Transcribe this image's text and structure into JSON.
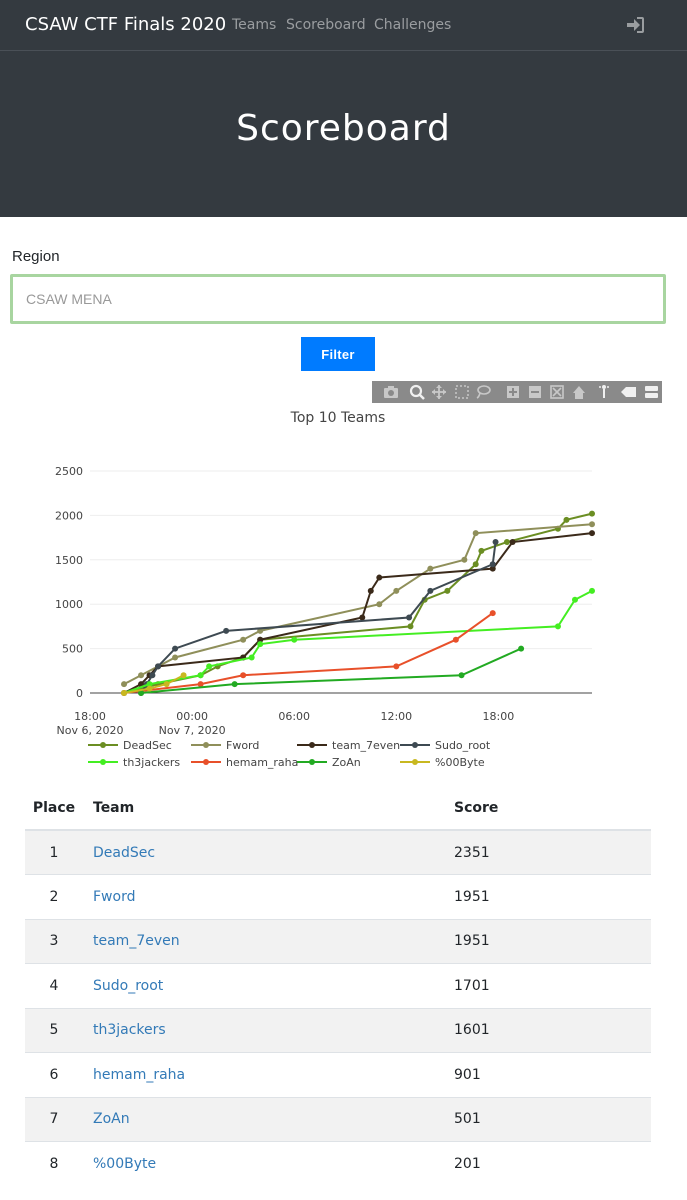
{
  "nav": {
    "brand": "CSAW CTF Finals 2020",
    "links": [
      "Teams",
      "Scoreboard",
      "Challenges"
    ]
  },
  "header": {
    "title": "Scoreboard"
  },
  "filter": {
    "label": "Region",
    "placeholder": "CSAW MENA",
    "button_label": "Filter"
  },
  "colors": {
    "nav_bg": "#343a40",
    "accent": "#007bff",
    "link": "#337ab7"
  },
  "chart_data": {
    "type": "line",
    "title": "Top 10 Teams",
    "xlabel": "",
    "ylabel": "",
    "ylim": [
      0,
      2500
    ],
    "yticks": [
      0,
      500,
      1000,
      1500,
      2000,
      2500
    ],
    "xlim": [
      "2020-11-06T18:00",
      "2020-11-07T23:30"
    ],
    "xticks": [
      {
        "at": "2020-11-06T18:00",
        "label": "18:00",
        "sub": "Nov 6, 2020"
      },
      {
        "at": "2020-11-07T00:00",
        "label": "00:00",
        "sub": "Nov 7, 2020"
      },
      {
        "at": "2020-11-07T06:00",
        "label": "06:00",
        "sub": ""
      },
      {
        "at": "2020-11-07T12:00",
        "label": "12:00",
        "sub": ""
      },
      {
        "at": "2020-11-07T18:00",
        "label": "18:00",
        "sub": ""
      }
    ],
    "legend_position": "bottom",
    "series": [
      {
        "name": "DeadSec",
        "color": "#6b8e23",
        "points": [
          [
            "2020-11-06T20:00",
            0
          ],
          [
            "2020-11-06T21:00",
            50
          ],
          [
            "2020-11-06T22:00",
            100
          ],
          [
            "2020-11-07T00:30",
            200
          ],
          [
            "2020-11-07T01:30",
            300
          ],
          [
            "2020-11-07T03:00",
            400
          ],
          [
            "2020-11-07T04:00",
            600
          ],
          [
            "2020-11-07T12:50",
            750
          ],
          [
            "2020-11-07T13:40",
            1050
          ],
          [
            "2020-11-07T15:00",
            1150
          ],
          [
            "2020-11-07T16:40",
            1450
          ],
          [
            "2020-11-07T17:00",
            1600
          ],
          [
            "2020-11-07T18:30",
            1700
          ],
          [
            "2020-11-07T21:30",
            1850
          ],
          [
            "2020-11-07T22:00",
            1950
          ],
          [
            "2020-11-07T23:30",
            2020
          ]
        ]
      },
      {
        "name": "Fword",
        "color": "#8f8f5a",
        "points": [
          [
            "2020-11-06T20:00",
            100
          ],
          [
            "2020-11-06T21:00",
            200
          ],
          [
            "2020-11-06T23:00",
            400
          ],
          [
            "2020-11-07T03:00",
            600
          ],
          [
            "2020-11-07T04:00",
            700
          ],
          [
            "2020-11-07T11:00",
            1000
          ],
          [
            "2020-11-07T12:00",
            1150
          ],
          [
            "2020-11-07T14:00",
            1400
          ],
          [
            "2020-11-07T16:00",
            1500
          ],
          [
            "2020-11-07T16:40",
            1800
          ],
          [
            "2020-11-07T23:30",
            1900
          ]
        ]
      },
      {
        "name": "team_7even",
        "color": "#3b2a1a",
        "points": [
          [
            "2020-11-06T20:00",
            0
          ],
          [
            "2020-11-06T21:00",
            100
          ],
          [
            "2020-11-06T21:30",
            200
          ],
          [
            "2020-11-06T22:00",
            300
          ],
          [
            "2020-11-07T03:00",
            400
          ],
          [
            "2020-11-07T04:00",
            600
          ],
          [
            "2020-11-07T10:00",
            850
          ],
          [
            "2020-11-07T10:30",
            1150
          ],
          [
            "2020-11-07T11:00",
            1300
          ],
          [
            "2020-11-07T17:40",
            1400
          ],
          [
            "2020-11-07T18:50",
            1700
          ],
          [
            "2020-11-07T23:30",
            1800
          ]
        ]
      },
      {
        "name": "Sudo_root",
        "color": "#3e4a52",
        "points": [
          [
            "2020-11-06T21:00",
            0
          ],
          [
            "2020-11-06T21:20",
            100
          ],
          [
            "2020-11-06T21:40",
            200
          ],
          [
            "2020-11-06T22:00",
            300
          ],
          [
            "2020-11-06T23:00",
            500
          ],
          [
            "2020-11-07T02:00",
            700
          ],
          [
            "2020-11-07T12:45",
            850
          ],
          [
            "2020-11-07T14:00",
            1150
          ],
          [
            "2020-11-07T17:40",
            1450
          ],
          [
            "2020-11-07T17:50",
            1700
          ]
        ]
      },
      {
        "name": "th3jackers",
        "color": "#44ee22",
        "points": [
          [
            "2020-11-06T20:00",
            0
          ],
          [
            "2020-11-06T21:30",
            100
          ],
          [
            "2020-11-07T00:30",
            200
          ],
          [
            "2020-11-07T01:00",
            300
          ],
          [
            "2020-11-07T03:30",
            400
          ],
          [
            "2020-11-07T04:00",
            550
          ],
          [
            "2020-11-07T06:00",
            600
          ],
          [
            "2020-11-07T21:30",
            750
          ],
          [
            "2020-11-07T22:30",
            1050
          ],
          [
            "2020-11-07T23:30",
            1150
          ]
        ]
      },
      {
        "name": "hemam_raha",
        "color": "#e8502a",
        "points": [
          [
            "2020-11-06T20:00",
            0
          ],
          [
            "2020-11-07T00:30",
            100
          ],
          [
            "2020-11-07T03:00",
            200
          ],
          [
            "2020-11-07T12:00",
            300
          ],
          [
            "2020-11-07T15:30",
            600
          ],
          [
            "2020-11-07T17:40",
            900
          ]
        ]
      },
      {
        "name": "ZoAn",
        "color": "#22aa22",
        "points": [
          [
            "2020-11-06T21:00",
            0
          ],
          [
            "2020-11-07T02:30",
            100
          ],
          [
            "2020-11-07T15:50",
            200
          ],
          [
            "2020-11-07T19:20",
            500
          ]
        ]
      },
      {
        "name": "%00Byte",
        "color": "#c8b820",
        "points": [
          [
            "2020-11-06T20:00",
            0
          ],
          [
            "2020-11-06T21:30",
            50
          ],
          [
            "2020-11-06T22:30",
            100
          ],
          [
            "2020-11-06T23:30",
            200
          ]
        ]
      }
    ]
  },
  "table": {
    "headers": {
      "place": "Place",
      "team": "Team",
      "score": "Score"
    },
    "rows": [
      {
        "place": "1",
        "team": "DeadSec",
        "score": "2351"
      },
      {
        "place": "2",
        "team": "Fword",
        "score": "1951"
      },
      {
        "place": "3",
        "team": "team_7even",
        "score": "1951"
      },
      {
        "place": "4",
        "team": "Sudo_root",
        "score": "1701"
      },
      {
        "place": "5",
        "team": "th3jackers",
        "score": "1601"
      },
      {
        "place": "6",
        "team": "hemam_raha",
        "score": "901"
      },
      {
        "place": "7",
        "team": "ZoAn",
        "score": "501"
      },
      {
        "place": "8",
        "team": "%00Byte",
        "score": "201"
      }
    ]
  }
}
